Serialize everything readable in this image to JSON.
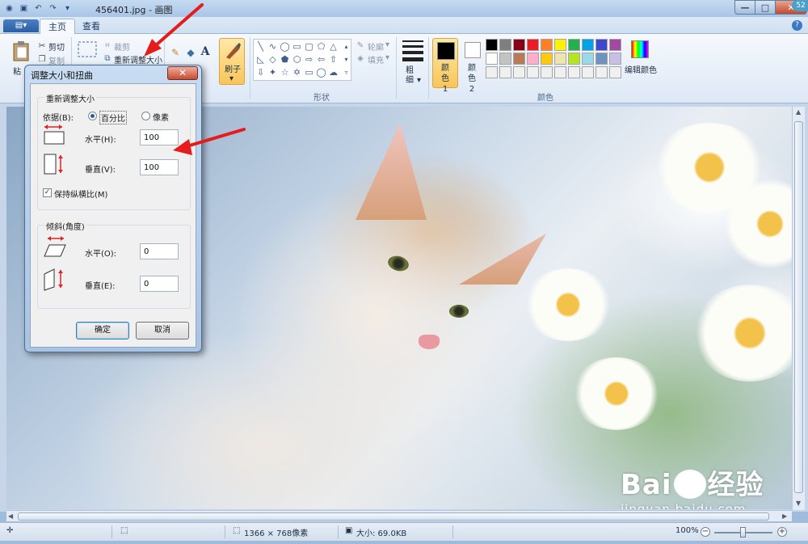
{
  "titlebar": {
    "title": "456401.jpg - 画图",
    "badge": "52"
  },
  "tabs": {
    "file": "▤▾",
    "home": "主页",
    "view": "查看"
  },
  "ribbon": {
    "clipboard": {
      "paste": "粘",
      "cut": "剪切",
      "copy": "复制"
    },
    "image": {
      "crop": "裁剪",
      "resize": "重新调整大小"
    },
    "brush": {
      "label": "刷子"
    },
    "shapes": {
      "outline": "轮廓",
      "fill": "填充",
      "group": "形状"
    },
    "size": {
      "label": "粗细"
    },
    "colors": {
      "color1": "颜色 1",
      "color2": "颜色 2",
      "edit": "编辑颜色",
      "group": "颜色",
      "palette": [
        "#000000",
        "#7f7f7f",
        "#880015",
        "#ed1c24",
        "#ff7f27",
        "#fff200",
        "#22b14c",
        "#00a2e8",
        "#3f48cc",
        "#a349a4",
        "#ffffff",
        "#c3c3c3",
        "#b97a57",
        "#ffaec9",
        "#ffc90e",
        "#efe4b0",
        "#b5e61d",
        "#99d9ea",
        "#7092be",
        "#c8bfe7",
        "#f0f0f0",
        "#f0f0f0",
        "#f0f0f0",
        "#f0f0f0",
        "#f0f0f0",
        "#f0f0f0",
        "#f0f0f0",
        "#f0f0f0",
        "#f0f0f0",
        "#f0f0f0"
      ]
    }
  },
  "dialog": {
    "title": "调整大小和扭曲",
    "resize_legend": "重新调整大小",
    "by_label": "依据(B):",
    "percent_label": "百分比",
    "pixels_label": "像素",
    "horizontal_label": "水平(H):",
    "horizontal_value": "100",
    "vertical_label": "垂直(V):",
    "vertical_value": "100",
    "keep_ratio_label": "保持纵横比(M)",
    "skew_legend": "倾斜(角度)",
    "skew_h_label": "水平(O):",
    "skew_h_value": "0",
    "skew_v_label": "垂直(E):",
    "skew_v_value": "0",
    "ok": "确定",
    "cancel": "取消"
  },
  "status": {
    "dimensions": "1366 × 768像素",
    "size": "大小: 69.0KB",
    "zoom": "100%"
  },
  "watermark": {
    "brand_left": "Bai",
    "brand_right": "经验",
    "url": "jingyan.baidu.com"
  }
}
